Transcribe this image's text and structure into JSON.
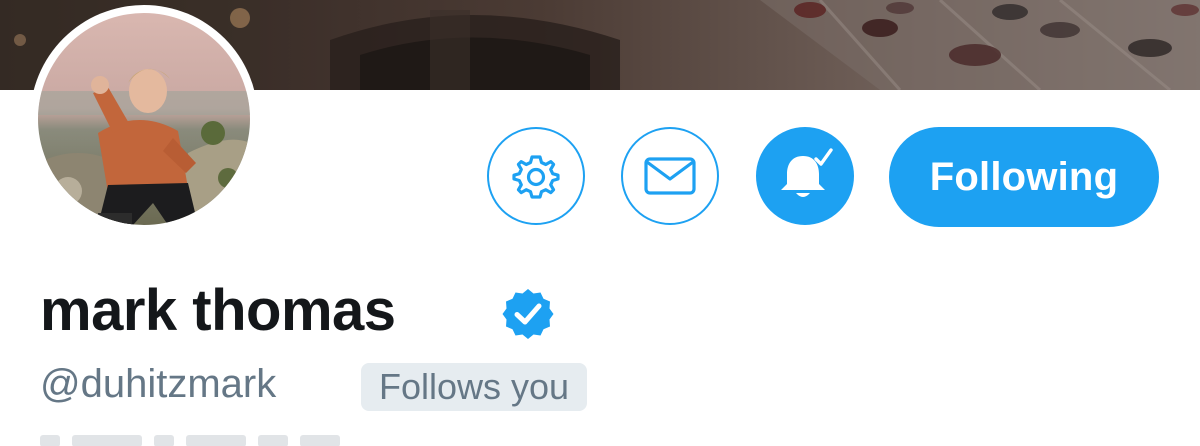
{
  "profile": {
    "display_name": "mark thomas",
    "handle": "@duhitzmark",
    "follows_you_badge": "Follows you",
    "verified": true
  },
  "actions": {
    "following_label": "Following",
    "settings_icon": "gear-icon",
    "message_icon": "envelope-icon",
    "notifications_icon": "bell-check-icon"
  },
  "colors": {
    "accent": "#1da1f2",
    "name_text": "#14171a",
    "secondary_text": "#657786",
    "badge_bg": "#e6ecf0"
  }
}
